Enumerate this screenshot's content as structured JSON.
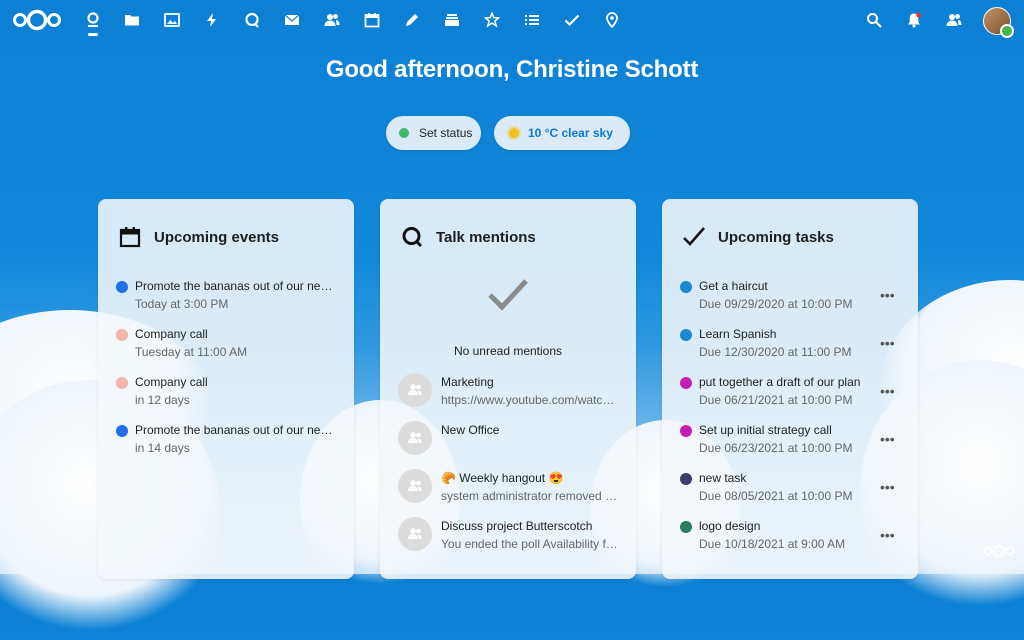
{
  "greeting": "Good afternoon, Christine Schott",
  "status": {
    "label": "Set status",
    "color": "#3fb86a"
  },
  "weather": {
    "label": "10 °C clear sky",
    "icon": "sun-icon"
  },
  "nav": [
    "dashboard-icon",
    "files-icon",
    "photos-icon",
    "activity-icon",
    "talk-icon",
    "mail-icon",
    "contacts-icon",
    "calendar-icon",
    "notes-icon",
    "deck-icon",
    "announcements-icon",
    "tasks-icon",
    "checklist-icon",
    "maps-icon"
  ],
  "events": {
    "title": "Upcoming events",
    "items": [
      {
        "title": "Promote the bananas out of our new pr...",
        "subtitle": "Today at 3:00 PM",
        "color": "#1e6fe8"
      },
      {
        "title": "Company call",
        "subtitle": "Tuesday at 11:00 AM",
        "color": "#f4b4ae"
      },
      {
        "title": "Company call",
        "subtitle": "in 12 days",
        "color": "#f4b4ae"
      },
      {
        "title": "Promote the bananas out of our new pr...",
        "subtitle": "in 14 days",
        "color": "#1e6fe8"
      }
    ]
  },
  "talk": {
    "title": "Talk mentions",
    "empty": "No unread mentions",
    "items": [
      {
        "title": "Marketing",
        "subtitle": "https://www.youtube.com/watch?..."
      },
      {
        "title": "New Office",
        "subtitle": ""
      },
      {
        "title": "🥐 Weekly hangout 😍",
        "subtitle": "system administrator removed ma..."
      },
      {
        "title": "Discuss project Butterscotch",
        "subtitle": "You ended the poll Availability for ..."
      }
    ]
  },
  "tasks": {
    "title": "Upcoming tasks",
    "more": "•••",
    "items": [
      {
        "title": "Get a haircut",
        "subtitle": "Due 09/29/2020 at 10:00 PM",
        "color": "#1a8ad0"
      },
      {
        "title": "Learn Spanish",
        "subtitle": "Due 12/30/2020 at 11:00 PM",
        "color": "#1a8ad0"
      },
      {
        "title": "put together a draft of our plan",
        "subtitle": "Due 06/21/2021 at 10:00 PM",
        "color": "#c41fb2"
      },
      {
        "title": "Set up initial strategy call",
        "subtitle": "Due 06/23/2021 at 10:00 PM",
        "color": "#c41fb2"
      },
      {
        "title": "new task",
        "subtitle": "Due 08/05/2021 at 10:00 PM",
        "color": "#3a3d6e"
      },
      {
        "title": "logo design",
        "subtitle": "Due 10/18/2021 at 9:00 AM",
        "color": "#2a7d5f"
      }
    ]
  }
}
